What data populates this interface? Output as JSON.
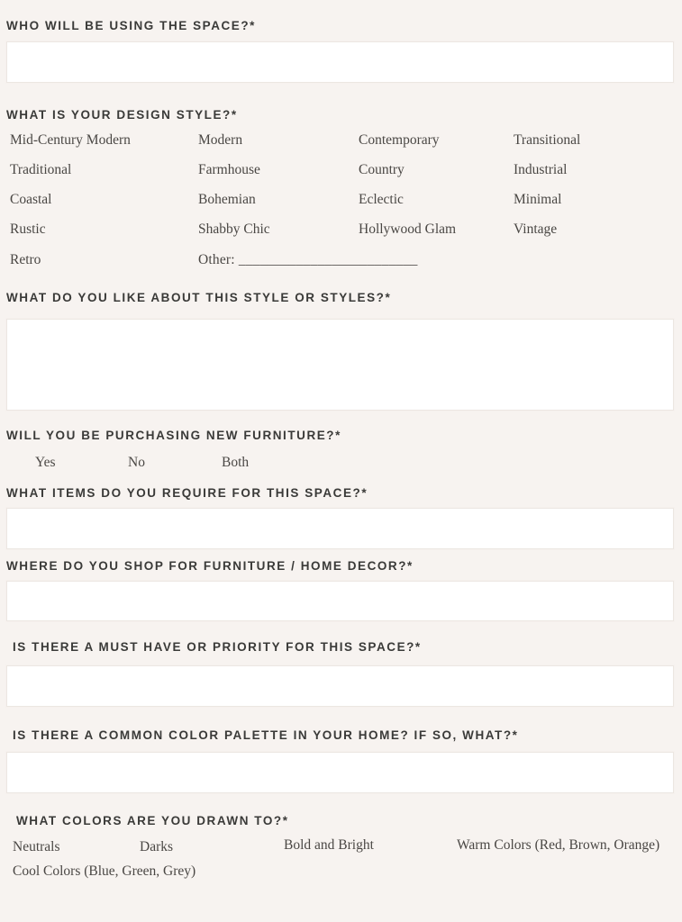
{
  "background_color": "#f7f3f0",
  "field_color": "#ffffff",
  "label_color": "#3a3a38",
  "option_color": "#4a4744",
  "sections": {
    "who_using": {
      "label": "WHO WILL BE USING THE SPACE?*",
      "input_value": "",
      "placeholder": ""
    },
    "design_style": {
      "label": "WHAT IS YOUR DESIGN STYLE?*",
      "options": [
        "Mid-Century Modern",
        "Modern",
        "Contemporary",
        "Transitional",
        "Traditional",
        "Farmhouse",
        "Country",
        "Industrial",
        "Coastal",
        "Bohemian",
        "Eclectic",
        "Minimal",
        "Rustic",
        "Shabby Chic",
        "Hollywood Glam",
        "Vintage",
        "Retro"
      ],
      "other_label": "Other: _________________________"
    },
    "like_about_style": {
      "label": "WHAT DO YOU LIKE ABOUT THIS STYLE OR STYLES?*",
      "input_value": "",
      "placeholder": ""
    },
    "purchasing_furniture": {
      "label": "WILL YOU BE PURCHASING NEW FURNITURE?*",
      "options": [
        "Yes",
        "No",
        "Both"
      ]
    },
    "items_required": {
      "label": "WHAT ITEMS DO YOU REQUIRE FOR THIS SPACE?*",
      "input_value": "",
      "placeholder": ""
    },
    "where_shop": {
      "label": "WHERE DO YOU SHOP FOR FURNITURE / HOME DECOR?*",
      "input_value": "",
      "placeholder": ""
    },
    "must_have": {
      "label": "IS THERE A MUST HAVE OR PRIORITY FOR THIS SPACE?*",
      "input_value": "",
      "placeholder": ""
    },
    "color_palette": {
      "label": "IS THERE A COMMON COLOR PALETTE IN YOUR HOME? IF SO, WHAT?*",
      "input_value": "",
      "placeholder": ""
    },
    "colors_drawn_to": {
      "label": "WHAT COLORS ARE YOU DRAWN TO?*",
      "options": [
        "Neutrals",
        "Darks",
        "Bold and Bright",
        "Warm Colors  (Red, Brown, Orange)",
        "Cool Colors (Blue, Green, Grey)"
      ]
    }
  }
}
